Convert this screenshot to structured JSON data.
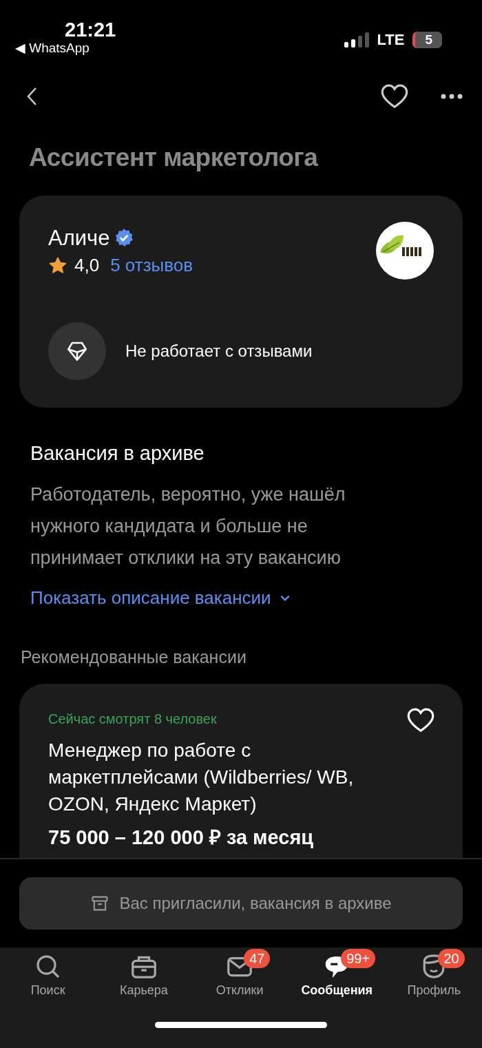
{
  "status_bar": {
    "time": "21:21",
    "back_app": "◀ WhatsApp",
    "network": "LTE",
    "battery": "5"
  },
  "nav": {
    "favorite": false
  },
  "title": "Ассистент маркетолога",
  "employer": {
    "name": "Аличе",
    "verified": true,
    "rating": "4,0",
    "reviews": "5 отзывов",
    "note": "Не работает с отзывами"
  },
  "archive": {
    "heading": "Вакансия в архиве",
    "text": "Работодатель, вероятно, уже нашёл нужного кандидата и больше не принимает отклики на эту вакансию",
    "link": "Показать описание вакансии",
    "expanded": false
  },
  "recommended": {
    "heading": "Рекомендованные вакансии",
    "items": [
      {
        "viewers": "Сейчас смотрят 8 человек",
        "title": "Менеджер по работе с маркетплейсами (Wildberries/ WB, OZON, Яндекс Маркет)",
        "salary": "75 000 – 120 000 ₽ за месяц",
        "favorite": false
      }
    ]
  },
  "banner": "Вас пригласили, вакансия в архиве",
  "tabs": [
    {
      "label": "Поиск",
      "selected": false
    },
    {
      "label": "Карьера",
      "selected": false
    },
    {
      "label": "Отклики",
      "badge": "47",
      "selected": false
    },
    {
      "label": "Сообщения",
      "badge": "99+",
      "selected": true
    },
    {
      "label": "Профиль",
      "badge": "20",
      "selected": false
    }
  ]
}
